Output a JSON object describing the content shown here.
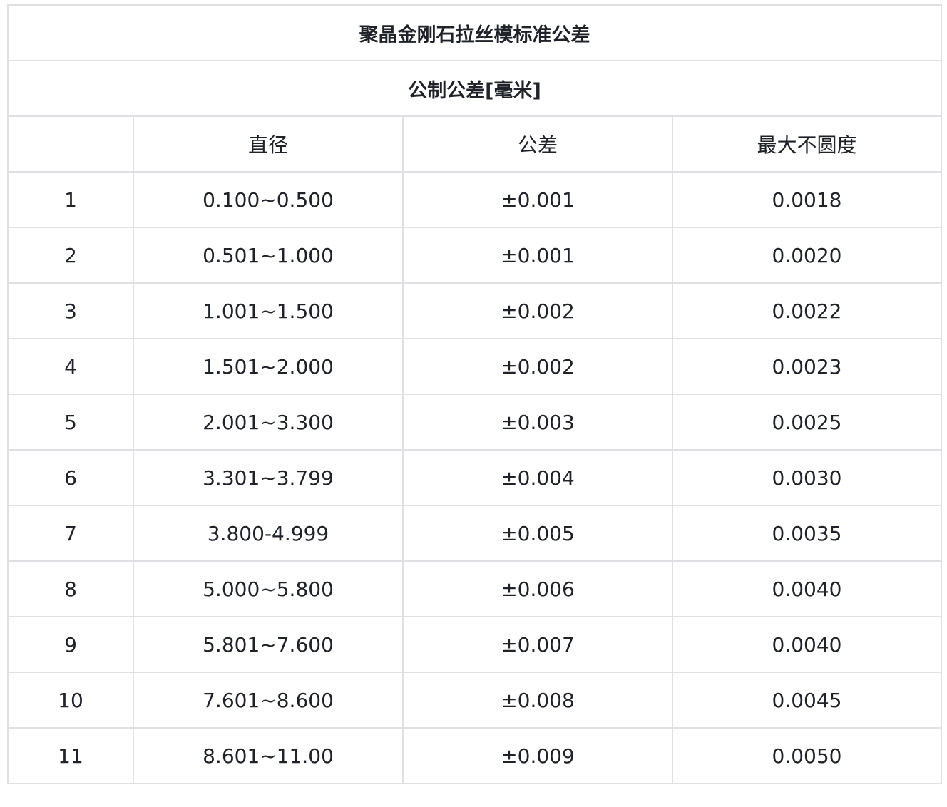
{
  "table": {
    "title": "聚晶金刚石拉丝模标准公差",
    "subtitle": "公制公差[毫米]",
    "headers": [
      "",
      "直径",
      "公差",
      "最大不圆度"
    ],
    "rows": [
      [
        "1",
        "0.100~0.500",
        "±0.001",
        "0.0018"
      ],
      [
        "2",
        "0.501~1.000",
        "±0.001",
        "0.0020"
      ],
      [
        "3",
        "1.001~1.500",
        "±0.002",
        "0.0022"
      ],
      [
        "4",
        "1.501~2.000",
        "±0.002",
        "0.0023"
      ],
      [
        "5",
        "2.001~3.300",
        "±0.003",
        "0.0025"
      ],
      [
        "6",
        "3.301~3.799",
        "±0.004",
        "0.0030"
      ],
      [
        "7",
        "3.800-4.999",
        "±0.005",
        "0.0035"
      ],
      [
        "8",
        "5.000~5.800",
        "±0.006",
        "0.0040"
      ],
      [
        "9",
        "5.801~7.600",
        "±0.007",
        "0.0040"
      ],
      [
        "10",
        "7.601~8.600",
        "±0.008",
        "0.0045"
      ],
      [
        "11",
        "8.601~11.00",
        "±0.009",
        "0.0050"
      ]
    ]
  }
}
